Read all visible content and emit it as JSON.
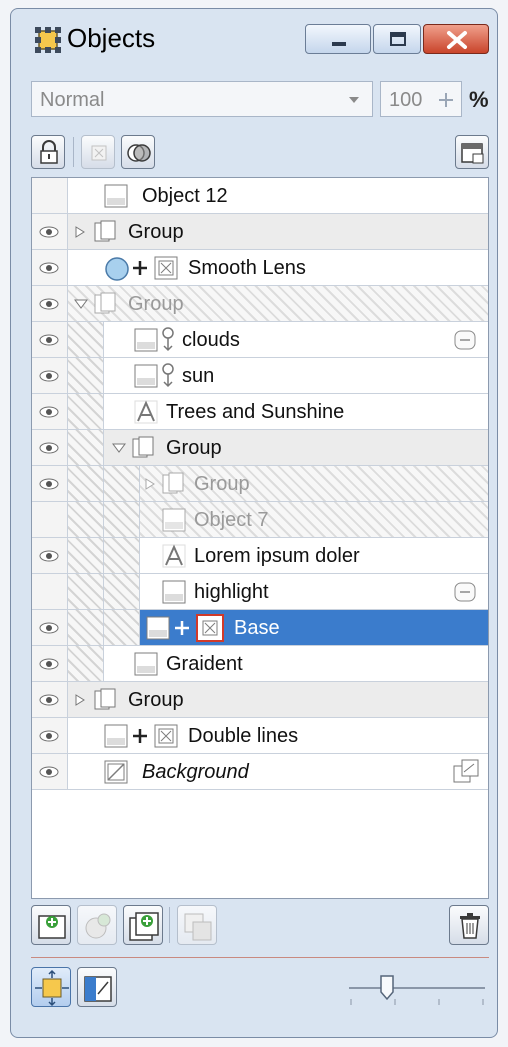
{
  "window": {
    "title": "Objects"
  },
  "blend": {
    "mode": "Normal",
    "opacity": "100",
    "unit": "%"
  },
  "colors": {
    "selection": "#3b7ccc",
    "close": "#c9442b",
    "accent_green": "#3aa03a"
  },
  "layers": [
    {
      "name": "Object 12"
    },
    {
      "name": "Group"
    },
    {
      "name": "Smooth Lens"
    },
    {
      "name": "Group"
    },
    {
      "name": "clouds"
    },
    {
      "name": "sun"
    },
    {
      "name": "Trees and Sunshine"
    },
    {
      "name": "Group"
    },
    {
      "name": "Group"
    },
    {
      "name": "Object 7"
    },
    {
      "name": "Lorem ipsum doler"
    },
    {
      "name": "highlight"
    },
    {
      "name": "Base"
    },
    {
      "name": "Graident"
    },
    {
      "name": "Group"
    },
    {
      "name": "Double lines"
    },
    {
      "name": "Background"
    }
  ],
  "selected_layer": "Base",
  "thumbnail_zoom_level": 0.25
}
